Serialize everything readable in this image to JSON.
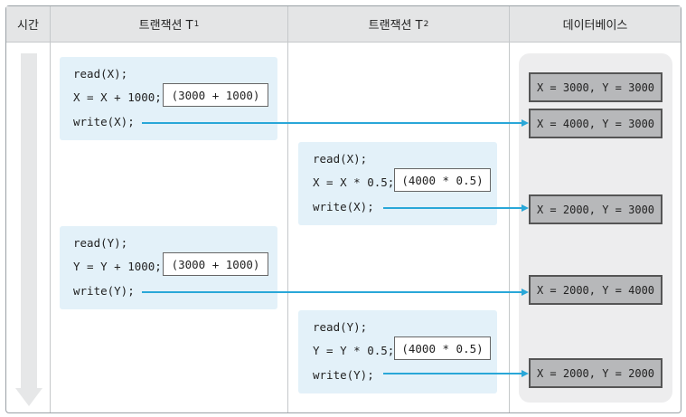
{
  "header": {
    "time": "시간",
    "t1_prefix": "트랜잭션 T",
    "t1_sub": "1",
    "t2_prefix": "트랜잭션 T",
    "t2_sub": "2",
    "db": "데이터베이스"
  },
  "t1_block1": {
    "line1": "read(X);",
    "line2": "X = X + 1000;",
    "calc": "(3000 + 1000)",
    "line3": "write(X);"
  },
  "t2_block1": {
    "line1": "read(X);",
    "line2": "X = X * 0.5;",
    "calc": "(4000 * 0.5)",
    "line3": "write(X);"
  },
  "t1_block2": {
    "line1": "read(Y);",
    "line2": "Y = Y + 1000;",
    "calc": "(3000 + 1000)",
    "line3": "write(Y);"
  },
  "t2_block2": {
    "line1": "read(Y);",
    "line2": "Y = Y * 0.5;",
    "calc": "(4000 * 0.5)",
    "line3": "write(Y);"
  },
  "db_states": [
    "X = 3000, Y = 3000",
    "X = 4000, Y = 3000",
    "X = 2000, Y = 3000",
    "X = 2000, Y = 4000",
    "X = 2000, Y = 2000"
  ],
  "colors": {
    "arrow": "#29a7d8",
    "block_bg": "#e3f1f9",
    "header_bg": "#e4e5e6",
    "db_state_bg": "#b7b8ba"
  }
}
